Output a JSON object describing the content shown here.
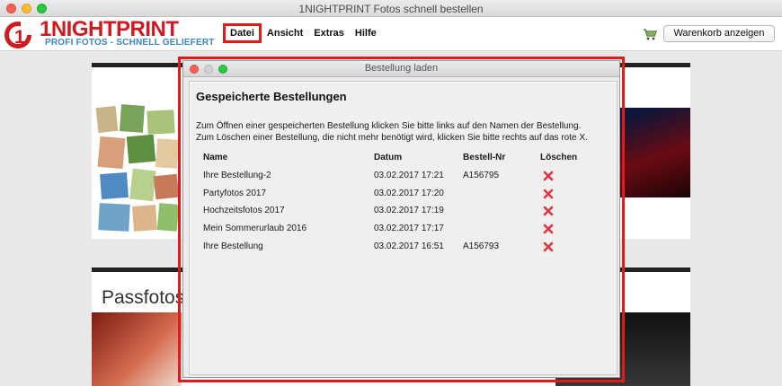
{
  "window": {
    "title": "1NIGHTPRINT Fotos schnell bestellen"
  },
  "brand": {
    "name": "1NIGHTPRINT",
    "tagline": "PROFI FOTOS - SCHNELL GELIEFERT",
    "red": "#d01a1f",
    "blue": "#3a86c8"
  },
  "menu": {
    "items": [
      {
        "label": "Datei",
        "active": true
      },
      {
        "label": "Ansicht"
      },
      {
        "label": "Extras"
      },
      {
        "label": "Hilfe"
      }
    ]
  },
  "cart": {
    "icon": "cart-icon",
    "label": "Warenkorb anzeigen"
  },
  "background": {
    "section2_title": "Passfotos"
  },
  "dialog": {
    "title": "Bestellung laden",
    "heading": "Gespeicherte Bestellungen",
    "description": "Zum Öffnen einer gespeicherten Bestellung klicken Sie bitte links auf den Namen der Bestellung. Zum Löschen einer Bestellung, die nicht mehr benötigt wird, klicken Sie bitte rechts auf das rote X.",
    "columns": {
      "name": "Name",
      "date": "Datum",
      "order_no": "Bestell-Nr",
      "delete": "Löschen"
    },
    "rows": [
      {
        "name": "Ihre Bestellung-2",
        "date": "03.02.2017 17:21",
        "order_no": "A156795"
      },
      {
        "name": "Partyfotos 2017",
        "date": "03.02.2017 17:20",
        "order_no": ""
      },
      {
        "name": "Hochzeitsfotos 2017",
        "date": "03.02.2017 17:19",
        "order_no": ""
      },
      {
        "name": "Mein Sommerurlaub 2016",
        "date": "03.02.2017 17:17",
        "order_no": ""
      },
      {
        "name": "Ihre Bestellung",
        "date": "03.02.2017 16:51",
        "order_no": "A156793"
      }
    ],
    "delete_icon": "delete-x-icon",
    "delete_color": "#e0343a"
  },
  "highlight_color": "#e21a1a"
}
